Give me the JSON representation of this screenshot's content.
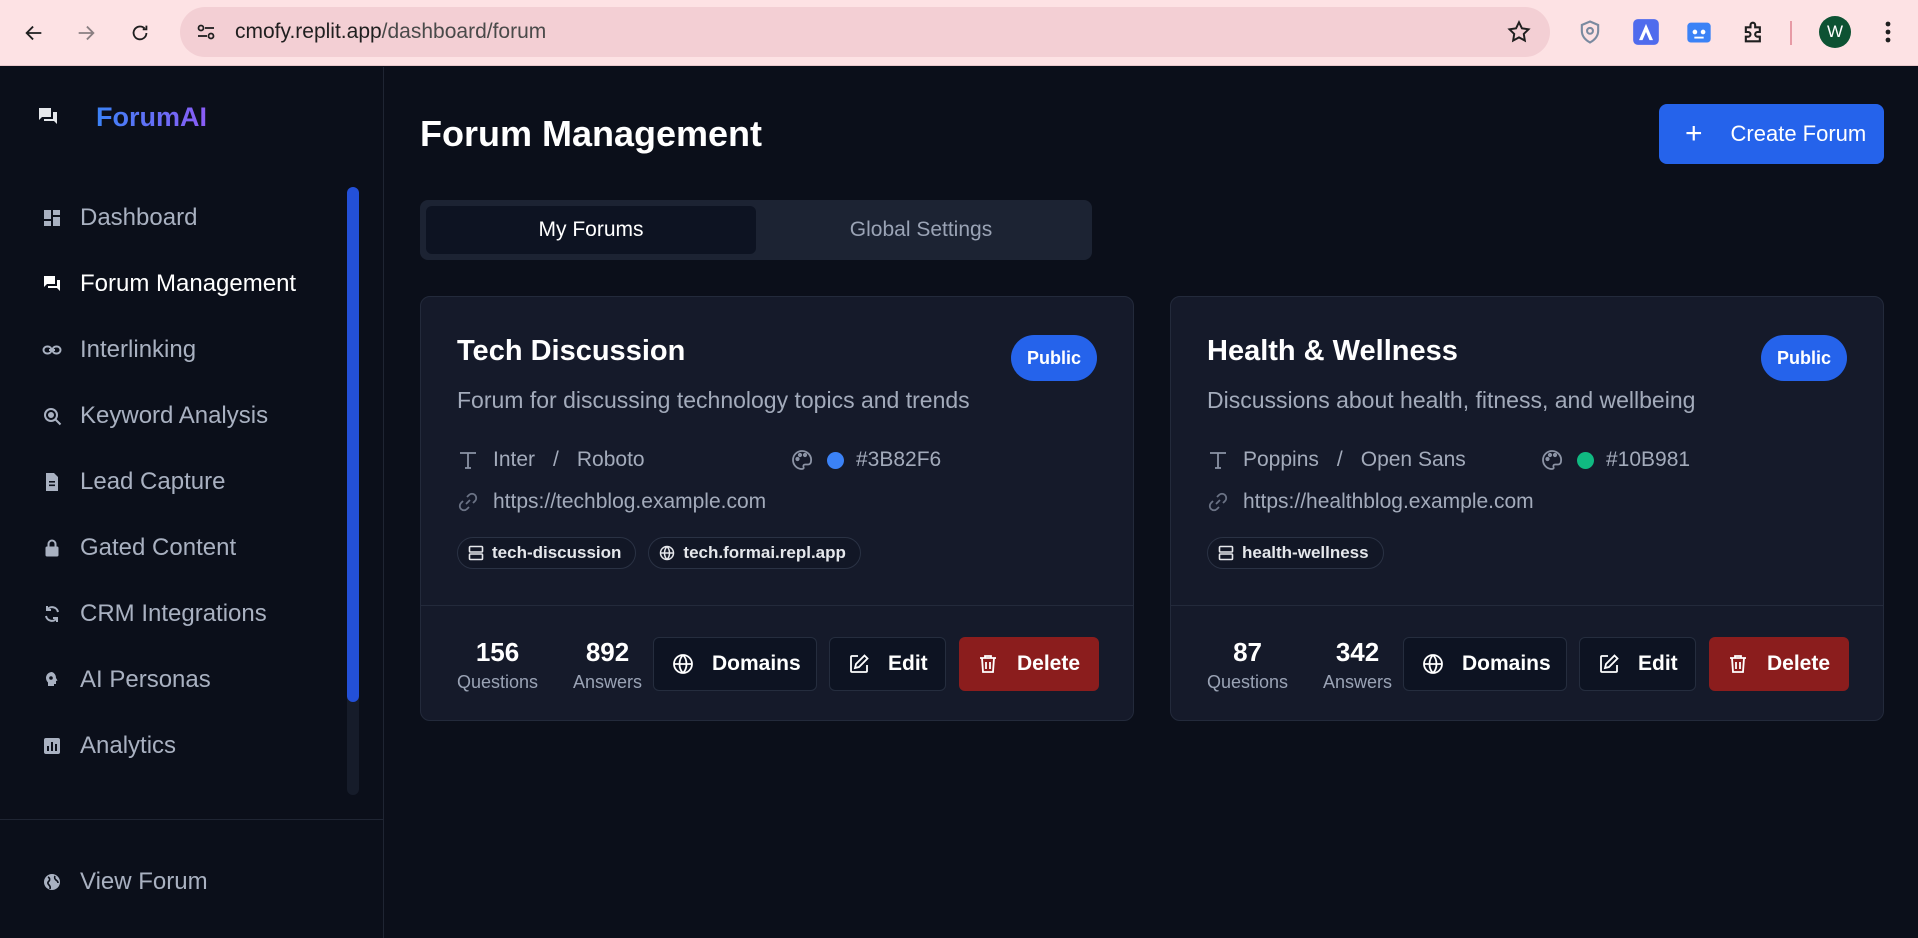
{
  "browser": {
    "url_host": "cmofy.replit.app",
    "url_path": "/dashboard/forum",
    "profile_initial": "W"
  },
  "sidebar": {
    "brand": "ForumAI",
    "items": [
      {
        "label": "Dashboard",
        "icon": "dashboard-icon"
      },
      {
        "label": "Forum Management",
        "icon": "forum-icon",
        "active": true
      },
      {
        "label": "Interlinking",
        "icon": "link-icon"
      },
      {
        "label": "Keyword Analysis",
        "icon": "keyword-search-icon"
      },
      {
        "label": "Lead Capture",
        "icon": "document-icon"
      },
      {
        "label": "Gated Content",
        "icon": "lock-icon"
      },
      {
        "label": "CRM Integrations",
        "icon": "sync-icon"
      },
      {
        "label": "AI Personas",
        "icon": "persona-icon"
      },
      {
        "label": "Analytics",
        "icon": "analytics-icon"
      }
    ],
    "footer_item": {
      "label": "View Forum",
      "icon": "globe-icon"
    }
  },
  "main": {
    "title": "Forum Management",
    "create_button": "Create Forum",
    "tabs": [
      {
        "label": "My Forums",
        "active": true
      },
      {
        "label": "Global Settings",
        "active": false
      }
    ],
    "forums": [
      {
        "name": "Tech Discussion",
        "visibility": "Public",
        "description": "Forum for discussing technology topics and trends",
        "heading_font": "Inter",
        "font_separator": "/",
        "body_font": "Roboto",
        "color_hex": "#3B82F6",
        "url": "https://techblog.example.com",
        "slug": "tech-discussion",
        "domain": "tech.formai.repl.app",
        "questions": "156",
        "questions_label": "Questions",
        "answers": "892",
        "answers_label": "Answers",
        "domains_label": "Domains",
        "edit_label": "Edit",
        "delete_label": "Delete"
      },
      {
        "name": "Health & Wellness",
        "visibility": "Public",
        "description": "Discussions about health, fitness, and wellbeing",
        "heading_font": "Poppins",
        "font_separator": "/",
        "body_font": "Open Sans",
        "color_hex": "#10B981",
        "url": "https://healthblog.example.com",
        "slug": "health-wellness",
        "questions": "87",
        "questions_label": "Questions",
        "answers": "342",
        "answers_label": "Answers",
        "domains_label": "Domains",
        "edit_label": "Edit",
        "delete_label": "Delete"
      }
    ]
  }
}
